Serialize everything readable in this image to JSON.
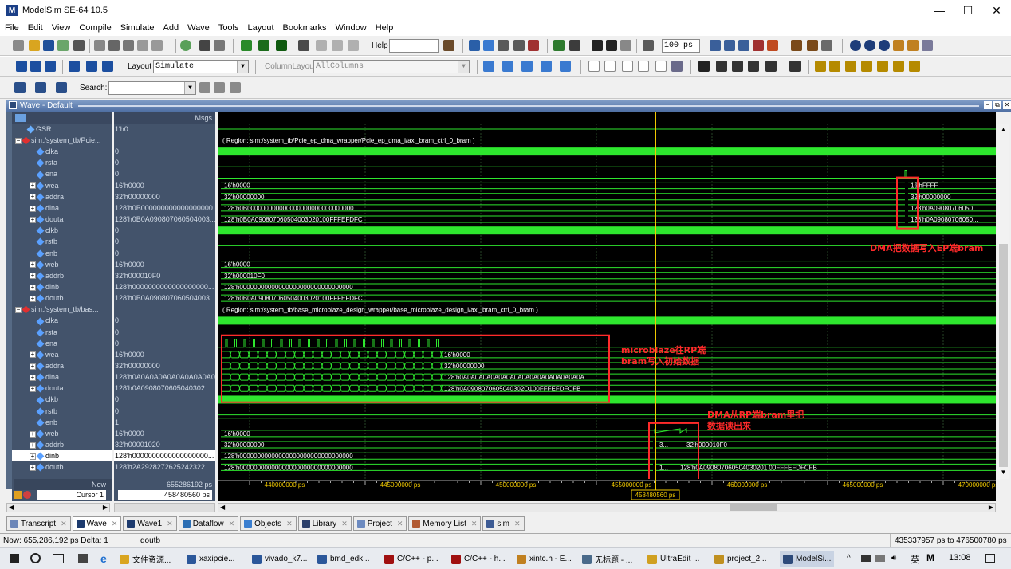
{
  "window": {
    "title": "ModelSim SE-64 10.5",
    "logo_letter": "M"
  },
  "menu": [
    "File",
    "Edit",
    "View",
    "Compile",
    "Simulate",
    "Add",
    "Wave",
    "Tools",
    "Layout",
    "Bookmarks",
    "Window",
    "Help"
  ],
  "toolbar": {
    "help_label": "Help",
    "time_step": "100 ps",
    "layout_label": "Layout",
    "layout_value": "Simulate",
    "column_layout_label": "ColumnLayout",
    "column_layout_value": "AllColumns",
    "search_label": "Search:"
  },
  "wave_window": {
    "title": "Wave - Default",
    "msgs_header": "Msgs",
    "top_clip": {
      "name": "GSR",
      "value": "1'h0"
    },
    "signals": [
      {
        "name": "sim:/system_tb/Pcie...",
        "value": "",
        "kind": "group"
      },
      {
        "name": "clka",
        "value": "0",
        "kind": "bit"
      },
      {
        "name": "rsta",
        "value": "0",
        "kind": "bit"
      },
      {
        "name": "ena",
        "value": "0",
        "kind": "bit"
      },
      {
        "name": "wea",
        "value": "16'h0000",
        "kind": "bus"
      },
      {
        "name": "addra",
        "value": "32'h00000000",
        "kind": "bus"
      },
      {
        "name": "dina",
        "value": "128'h0B000000000000000000...",
        "kind": "bus"
      },
      {
        "name": "douta",
        "value": "128'h0B0A090807060504003...",
        "kind": "bus"
      },
      {
        "name": "clkb",
        "value": "0",
        "kind": "bit"
      },
      {
        "name": "rstb",
        "value": "0",
        "kind": "bit"
      },
      {
        "name": "enb",
        "value": "0",
        "kind": "bit"
      },
      {
        "name": "web",
        "value": "16'h0000",
        "kind": "bus"
      },
      {
        "name": "addrb",
        "value": "32'h000010F0",
        "kind": "bus"
      },
      {
        "name": "dinb",
        "value": "128'h0000000000000000000...",
        "kind": "bus"
      },
      {
        "name": "doutb",
        "value": "128'h0B0A090807060504003...",
        "kind": "bus"
      },
      {
        "name": "sim:/system_tb/bas...",
        "value": "",
        "kind": "group"
      },
      {
        "name": "clka",
        "value": "0",
        "kind": "bit"
      },
      {
        "name": "rsta",
        "value": "0",
        "kind": "bit"
      },
      {
        "name": "ena",
        "value": "0",
        "kind": "bit"
      },
      {
        "name": "wea",
        "value": "16'h0000",
        "kind": "bus"
      },
      {
        "name": "addra",
        "value": "32'h00000000",
        "kind": "bus"
      },
      {
        "name": "dina",
        "value": "128'h0A0A0A0A0A0A0A0A0A0...",
        "kind": "bus"
      },
      {
        "name": "douta",
        "value": "128'h0A0908070605040302...",
        "kind": "bus"
      },
      {
        "name": "clkb",
        "value": "0",
        "kind": "bit"
      },
      {
        "name": "rstb",
        "value": "0",
        "kind": "bit"
      },
      {
        "name": "enb",
        "value": "1",
        "kind": "bit"
      },
      {
        "name": "web",
        "value": "16'h0000",
        "kind": "bus"
      },
      {
        "name": "addrb",
        "value": "32'h00001020",
        "kind": "bus"
      },
      {
        "name": "dinb",
        "value": "128'h0000000000000000000...",
        "kind": "bus",
        "selected": true
      },
      {
        "name": "doutb",
        "value": "128'h2A2928272625242322...",
        "kind": "bus"
      }
    ],
    "wave_labels": {
      "region1": "( Region: sim:/system_tb/Pcie_ep_dma_wrapper/Pcie_ep_dma_i/axi_bram_ctrl_0_bram )",
      "region2": "( Region: sim:/system_tb/base_microblaze_design_wrapper/base_microblaze_design_i/axi_bram_ctrl_0_bram )",
      "ep_wea": "16'h0000",
      "ep_addra": "32'h00000000",
      "ep_dina": "128'h0B000000000000000000000000000000",
      "ep_douta": "128'h0B0A090807060504003020100FFFEFDFC",
      "ep_wea_new": "16'hFFFF",
      "ep_addra_new": "32'h00000000",
      "ep_dina_new": "128'h0A09080706050...",
      "ep_douta_new": "128'h0A09080706050...",
      "ep_web": "16'h0000",
      "ep_addrb": "32'h000010F0",
      "ep_dinb": "128'h00000000000000000000000000000000",
      "ep_doutb": "128'h0B0A090807060504003020100FFFEFDFC",
      "rp_wea": "16'h0000",
      "rp_addra": "32'h00000000",
      "rp_dina": "128'h0A0A0A0A0A0A0A0A0A0A0A0A0A0A0A0A",
      "rp_douta": "128'h0A0908070605040302O100FFFEFDFCFB",
      "rp_web": "16'h0000",
      "rp_addrb": "32'h00000000",
      "rp_addrb_mid": "3...",
      "rp_addrb_new": "32'h000010F0",
      "rp_dinb": "128'h00000000000000000000000000000000",
      "rp_doutb": "128'h00000000000000000000000000000000",
      "rp_doutb_mid": "1...",
      "rp_doutb_new": "128'h0A090807060504030201 00FFFEFDFCFB"
    },
    "annotations": [
      {
        "text": "DMA把数据写入EP端bram",
        "color": "#ff2a2a"
      },
      {
        "text": "microblaze往RP端\nbram写入初始数据",
        "color": "#ff2a2a"
      },
      {
        "text": "DMA从RP端bram里把\n数据读出来",
        "color": "#ff2a2a"
      }
    ],
    "bottom": {
      "now_label": "Now",
      "now_value": "655286192 ps",
      "cursor_label": "Cursor 1",
      "cursor_value": "458480560 ps",
      "cursor_flag": "458480560 ps",
      "ticks": [
        "440000000 ps",
        "445000000 ps",
        "450000000 ps",
        "455000000 ps",
        "460000000 ps",
        "465000000 ps",
        "470000000 ps",
        "475000000 ps"
      ]
    }
  },
  "tabs": [
    {
      "label": "Transcript",
      "color": "#6b86b8"
    },
    {
      "label": "Wave",
      "color": "#1c3a6e",
      "active": true
    },
    {
      "label": "Wave1",
      "color": "#1c3a6e"
    },
    {
      "label": "Dataflow",
      "color": "#2d6fb4"
    },
    {
      "label": "Objects",
      "color": "#3b7fd0"
    },
    {
      "label": "Library",
      "color": "#2b3f6a"
    },
    {
      "label": "Project",
      "color": "#6c8ac0"
    },
    {
      "label": "Memory List",
      "color": "#b25a33"
    },
    {
      "label": "sim",
      "color": "#3d5b94"
    }
  ],
  "statusbar": {
    "now": "Now: 655,286,192 ps  Delta: 1",
    "signal": "doutb",
    "range": "435337957 ps to 476500780 ps"
  },
  "taskbar": {
    "items": [
      "文件资源...",
      "xaxipcie...",
      "vivado_k7...",
      "bmd_edk...",
      "C/C++ - p...",
      "C/C++ - h...",
      "xintc.h - E...",
      "无标题 - ...",
      "UltraEdit ...",
      "project_2...",
      "ModelSi..."
    ],
    "ime": "英",
    "clock": "13:08"
  },
  "colors": {
    "signal_green": "#2ee62e",
    "dark_bg": "#000000",
    "cursor_yellow": "#f0c800",
    "annotation_red": "#ff2a2a"
  }
}
